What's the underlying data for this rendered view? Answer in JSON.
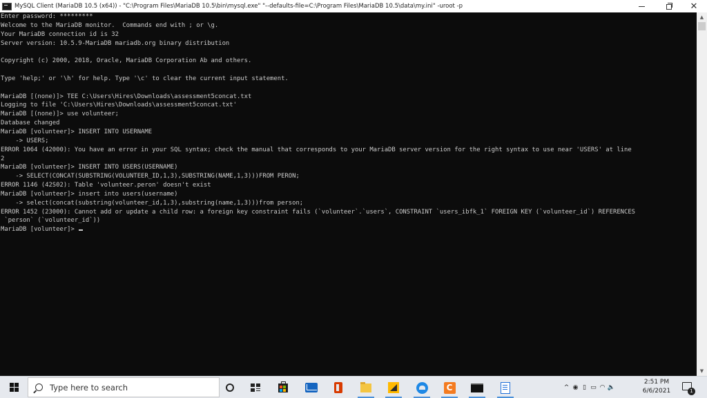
{
  "window": {
    "title": "MySQL Client (MariaDB 10.5 (x64)) - \"C:\\Program Files\\MariaDB 10.5\\bin\\mysql.exe\" \"--defaults-file=C:\\Program Files\\MariaDB 10.5\\data\\my.ini\" -uroot -p",
    "minimize_icon": "minimize-icon",
    "maximize_icon": "restore-icon",
    "close_icon": "close-icon",
    "close_glyph": "✕"
  },
  "console": {
    "lines": [
      "Enter password: *********",
      "Welcome to the MariaDB monitor.  Commands end with ; or \\g.",
      "Your MariaDB connection id is 32",
      "Server version: 10.5.9-MariaDB mariadb.org binary distribution",
      "",
      "Copyright (c) 2000, 2018, Oracle, MariaDB Corporation Ab and others.",
      "",
      "Type 'help;' or '\\h' for help. Type '\\c' to clear the current input statement.",
      "",
      "MariaDB [(none)]> TEE C:\\Users\\Hires\\Downloads\\assessment5concat.txt",
      "Logging to file 'C:\\Users\\Hires\\Downloads\\assessment5concat.txt'",
      "MariaDB [(none)]> use volunteer;",
      "Database changed",
      "MariaDB [volunteer]> INSERT INTO USERNAME",
      "    -> USERS;",
      "ERROR 1064 (42000): You have an error in your SQL syntax; check the manual that corresponds to your MariaDB server version for the right syntax to use near 'USERS' at line",
      "2",
      "MariaDB [volunteer]> INSERT INTO USERS(USERNAME)",
      "    -> SELECT(CONCAT(SUBSTRING(VOLUNTEER_ID,1,3),SUBSTRING(NAME,1,3)))FROM PERON;",
      "ERROR 1146 (42S02): Table 'volunteer.peron' doesn't exist",
      "MariaDB [volunteer]> insert into users(username)",
      "    -> select(concat(substring(volunteer_id,1,3),substring(name,1,3)))from person;",
      "ERROR 1452 (23000): Cannot add or update a child row: a foreign key constraint fails (`volunteer`.`users`, CONSTRAINT `users_ibfk_1` FOREIGN KEY (`volunteer_id`) REFERENCES",
      " `person` (`volunteer_id`))"
    ],
    "prompt": "MariaDB [volunteer]> "
  },
  "scrollbar": {
    "up_glyph": "▲",
    "down_glyph": "▼"
  },
  "taskbar": {
    "search_placeholder": "Type here to search",
    "pinned_icons": [
      "cortana-icon",
      "task-view-icon",
      "store-icon",
      "mail-icon",
      "office-icon",
      "file-explorer-icon",
      "app-icon",
      "edge-icon",
      "app-c-icon",
      "terminal-icon",
      "document-icon"
    ],
    "app_c_label": "C",
    "tray": {
      "chevron": "^",
      "speaker": "🔈",
      "time": "2:51 PM",
      "date": "6/6/2021",
      "notification_count": "1"
    },
    "underline_color": "#4a90d9"
  }
}
